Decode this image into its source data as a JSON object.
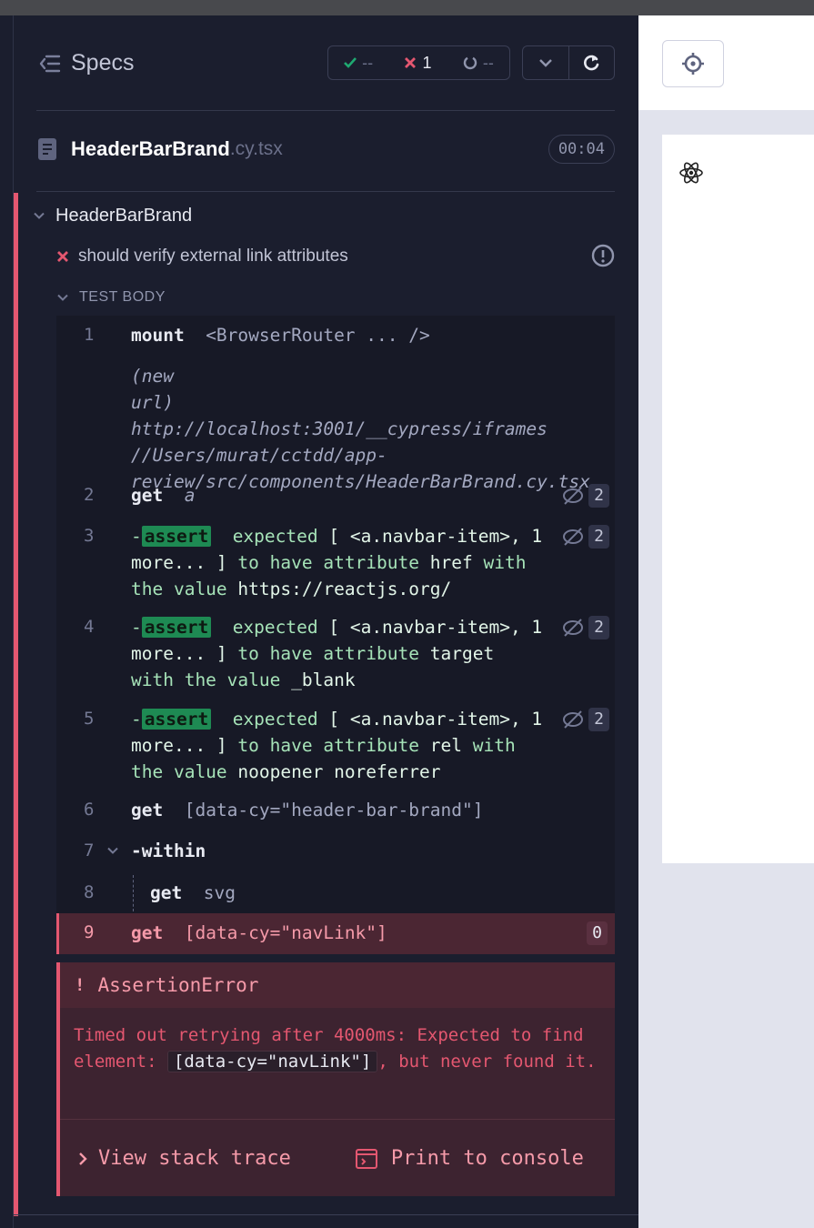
{
  "header": {
    "title": "Specs",
    "stats": {
      "passed": "--",
      "failed": "1",
      "pending": "--"
    }
  },
  "file": {
    "name": "HeaderBarBrand",
    "ext": ".cy.tsx",
    "duration": "00:04"
  },
  "suite": {
    "title": "HeaderBarBrand"
  },
  "test": {
    "title": "should verify external link attributes"
  },
  "body_label": "TEST BODY",
  "commands": [
    {
      "n": "1",
      "name": "mount",
      "value": "<BrowserRouter ... />"
    },
    {
      "label1": "(new",
      "label2": "url)",
      "lines": [
        "http://localhost:3001/__cypress/iframes",
        "//Users/murat/cctdd/app-",
        "review/src/components/HeaderBarBrand.cy.tsx"
      ]
    },
    {
      "n": "2",
      "name": "get",
      "value": "a",
      "count": "2"
    },
    {
      "n": "3",
      "dash": "-",
      "badge": "assert",
      "expected": "expected",
      "t1": "[ <a.navbar-item>, 1",
      "t2": "more... ]",
      "to": "to have attribute",
      "attr": "href",
      "with": "with",
      "the_value": "the value",
      "val": "https://reactjs.org/",
      "count": "2"
    },
    {
      "n": "4",
      "dash": "-",
      "badge": "assert",
      "expected": "expected",
      "t1": "[ <a.navbar-item>, 1",
      "t2": "more... ]",
      "to": "to have attribute",
      "attr": "target",
      "with_the_value": "with the value",
      "val": "_blank",
      "count": "2"
    },
    {
      "n": "5",
      "dash": "-",
      "badge": "assert",
      "expected": "expected",
      "t1": "[ <a.navbar-item>, 1",
      "t2": "more... ]",
      "to": "to have attribute",
      "attr": "rel",
      "with": "with",
      "the_value": "the value",
      "val": "noopener noreferrer",
      "count": "2"
    },
    {
      "n": "6",
      "name": "get",
      "value": "[data-cy=\"header-bar-brand\"]"
    },
    {
      "n": "7",
      "name": "-within"
    },
    {
      "n": "8",
      "name": "get",
      "value": "svg"
    },
    {
      "n": "9",
      "name": "get",
      "value": "[data-cy=\"navLink\"]",
      "count": "0"
    }
  ],
  "error": {
    "bang": "!",
    "title": "AssertionError",
    "msg_pre": "Timed out retrying after 4000ms: Expected to find element:",
    "msg_code": "[data-cy=\"navLink\"]",
    "msg_post": ", but never found it.",
    "stack_label": "View stack trace",
    "print_label": "Print to console"
  },
  "colors": {
    "fail": "#e45770",
    "pass": "#1fa971",
    "badge": "#1e8a53"
  }
}
